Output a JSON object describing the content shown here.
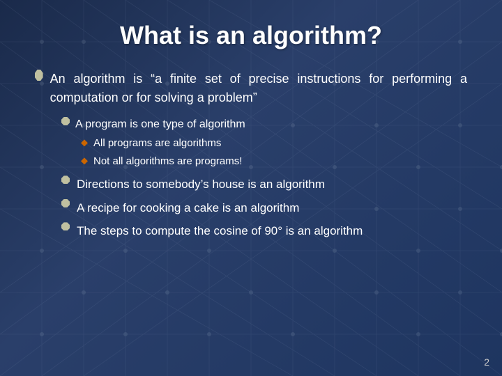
{
  "slide": {
    "title": "What is an algorithm?",
    "slide_number": "2",
    "main_bullet": {
      "text": "An algorithm is “a finite set of precise instructions for performing a computation or for solving a problem”"
    },
    "sub_bullets": [
      {
        "text": "A program is one type of algorithm",
        "level2": [
          {
            "text": "All programs are algorithms"
          },
          {
            "text": "Not all algorithms are programs!"
          }
        ]
      }
    ],
    "level2_bullets": [
      {
        "text": "Directions to somebody’s house is an algorithm"
      },
      {
        "text": "A recipe for cooking a cake is an algorithm"
      },
      {
        "text": "The steps to compute the cosine of 90° is an algorithm"
      }
    ]
  }
}
